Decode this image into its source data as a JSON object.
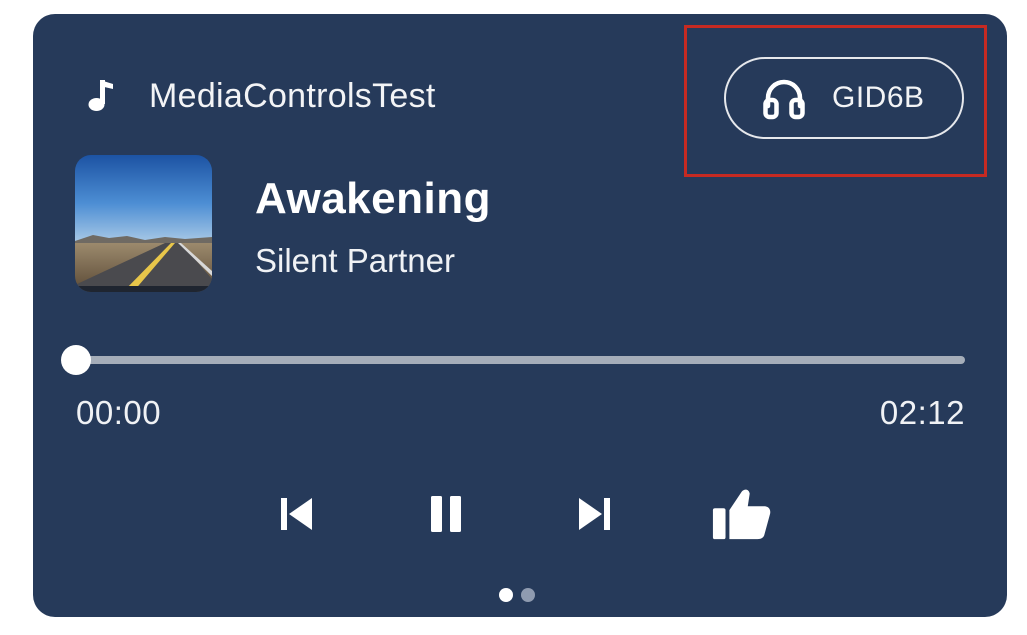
{
  "app": {
    "name": "MediaControlsTest",
    "icon": "music-note-icon"
  },
  "output_device": {
    "label": "GID6B",
    "icon": "headphones-icon"
  },
  "track": {
    "title": "Awakening",
    "artist": "Silent Partner",
    "artwork": "album-art-desert-road"
  },
  "progress": {
    "elapsed": "00:00",
    "total": "02:12",
    "fraction": 0.0
  },
  "controls": [
    {
      "name": "skip-previous",
      "icon": "skip-previous-icon"
    },
    {
      "name": "pause",
      "icon": "pause-icon"
    },
    {
      "name": "skip-next",
      "icon": "skip-next-icon"
    },
    {
      "name": "thumbs-up",
      "icon": "thumbs-up-icon"
    }
  ],
  "pager": {
    "count": 2,
    "active": 0
  },
  "colors": {
    "card_background": "#263a5a",
    "foreground": "#ffffff",
    "track_inactive": "#a5adb9",
    "highlight": "#c62a22",
    "dot_inactive": "#8f9bb0"
  }
}
